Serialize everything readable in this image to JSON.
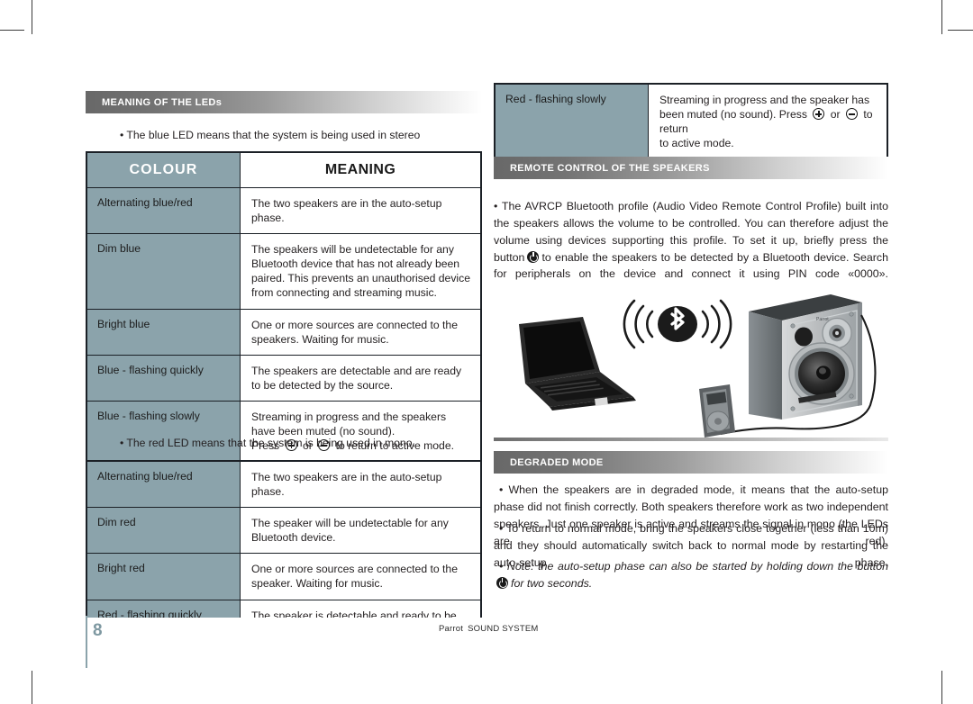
{
  "page": {
    "number": "8",
    "footer_brand_left": "Parrot",
    "footer_brand_right": "SOUND SYSTEM"
  },
  "sections": {
    "leds": {
      "title": "MEANING OF THE LEDs",
      "bullet_stereo": "• The blue LED means that the system is being used in stereo",
      "bullet_mono": "• The red LED means that the system is being used in mono."
    },
    "remote": {
      "title": "REMOTE CONTROL OF THE SPEAKERS",
      "paragraph_a": "• The AVRCP Bluetooth profile (Audio Video Remote Control Profile) built into the speakers allows the volume to be controlled. You can therefore adjust the volume using devices supporting this profile. To set it up, briefly press the button",
      "paragraph_b": "to enable the speakers to be detected by a Bluetooth device. Search for peripherals on the device and connect it using PIN code «0000»."
    },
    "degraded": {
      "title": "DEGRADED MODE",
      "paragraph_1": "• When the speakers are in degraded mode, it means that the auto-setup phase did not finish correctly. Both speakers therefore work as two independent speakers. Just one speaker is active and streams the signal in mono (the LEDs are red).",
      "paragraph_2": "• To return to normal mode, bring the speakers close together (less than 10m) and they should automatically switch back to normal mode by restarting the auto-setup phase.",
      "paragraph_3_a": "• Note: the auto-setup phase can also be started by holding down the button",
      "paragraph_3_b": "for two seconds."
    }
  },
  "table_blue": {
    "headers": {
      "colour": "COLOUR",
      "meaning": "MEANING"
    },
    "rows": [
      {
        "colour": "Alternating blue/red",
        "meaning": "The two speakers are in the auto-setup phase."
      },
      {
        "colour": "Dim blue",
        "meaning": "The speakers will be undetectable for any Bluetooth device that has not already been paired. This prevents an unauthorised device from connecting and streaming music."
      },
      {
        "colour": "Bright blue",
        "meaning": "One or more sources are connected to the speakers. Waiting for music."
      },
      {
        "colour": "Blue - flashing quickly",
        "meaning": "The speakers are detectable and are ready to be detected by the source."
      },
      {
        "colour": "Blue - flashing slowly",
        "meaning_line1": "Streaming in progress and the speakers have been muted (no sound).",
        "meaning_line2_a": "Press",
        "meaning_line2_or": "or",
        "meaning_line2_b": "to return to active mode."
      }
    ]
  },
  "table_red": {
    "rows": [
      {
        "colour": "Alternating blue/red",
        "meaning": "The two speakers are in the auto-setup phase."
      },
      {
        "colour": "Dim red",
        "meaning": "The speaker will be undetectable for any Bluetooth device."
      },
      {
        "colour": "Bright red",
        "meaning": "One or more sources are connected to the speaker. Waiting for music."
      },
      {
        "colour": "Red - flashing quickly",
        "meaning": "The speaker is detectable and ready to be detected."
      }
    ]
  },
  "table_red_continued": {
    "row": {
      "colour": "Red - flashing slowly",
      "meaning_a": "Streaming in progress and the speaker has been muted (no sound). Press",
      "meaning_or": "or",
      "meaning_b": "to return",
      "meaning_c": "to active mode."
    }
  },
  "illustration": {
    "name": "bluetooth-streaming-diagram",
    "devices": [
      "laptop",
      "bluetooth-symbol",
      "mp3-player",
      "speaker"
    ],
    "symbol": "bluetooth"
  },
  "colors": {
    "table_accent": "#8ba3ab",
    "bar_dark": "#686868",
    "text": "#231f20",
    "page_number": "#7e98a1"
  }
}
